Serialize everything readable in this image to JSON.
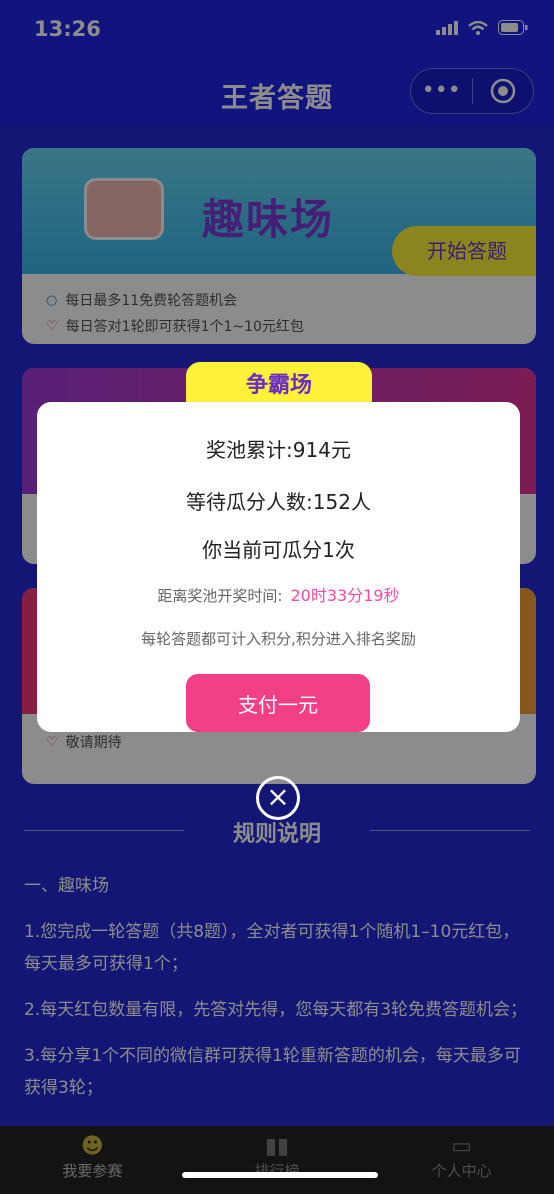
{
  "status_bar": {
    "time": "13:26"
  },
  "nav": {
    "title": "王者答题",
    "more_icon": "more-dots-icon",
    "record_icon": "record-icon"
  },
  "card1": {
    "name": "趣味场",
    "start_label": "开始答题",
    "tips": [
      "每日最多11免费轮答题机会",
      "每日答对1轮即可获得1个1~10元红包"
    ]
  },
  "card3": {
    "tip": "敬请期待"
  },
  "modal": {
    "tab_label": "争霸场",
    "pool_total": "奖池累计:914元",
    "waiting": "等待瓜分人数:152人",
    "my_chances": "你当前可瓜分1次",
    "countdown_label": "距离奖池开奖时间:",
    "countdown_value": "20时33分19秒",
    "note": "每轮答题都可计入积分,积分进入排名奖励",
    "pay_label": "支付一元"
  },
  "rules": {
    "title": "规则说明",
    "section1": "一、趣味场",
    "items": [
      "1.您完成一轮答题（共8题），全对者可获得1个随机1–10元红包，每天最多可获得1个；",
      "2.每天红包数量有限，先答对先得，您每天都有3轮免费答题机会；",
      "3.每分享1个不同的微信群可获得1轮重新答题的机会，每天最多可获得3轮；"
    ]
  },
  "tabbar": {
    "tabs": [
      {
        "label": "我要参赛",
        "icon": "smiley-icon"
      },
      {
        "label": "排行榜",
        "icon": "chart-icon"
      },
      {
        "label": "个人中心",
        "icon": "wallet-icon"
      }
    ]
  },
  "colors": {
    "nav_bg": "#1f23e6",
    "accent_pink": "#f23f85",
    "accent_yellow": "#fff13a"
  }
}
